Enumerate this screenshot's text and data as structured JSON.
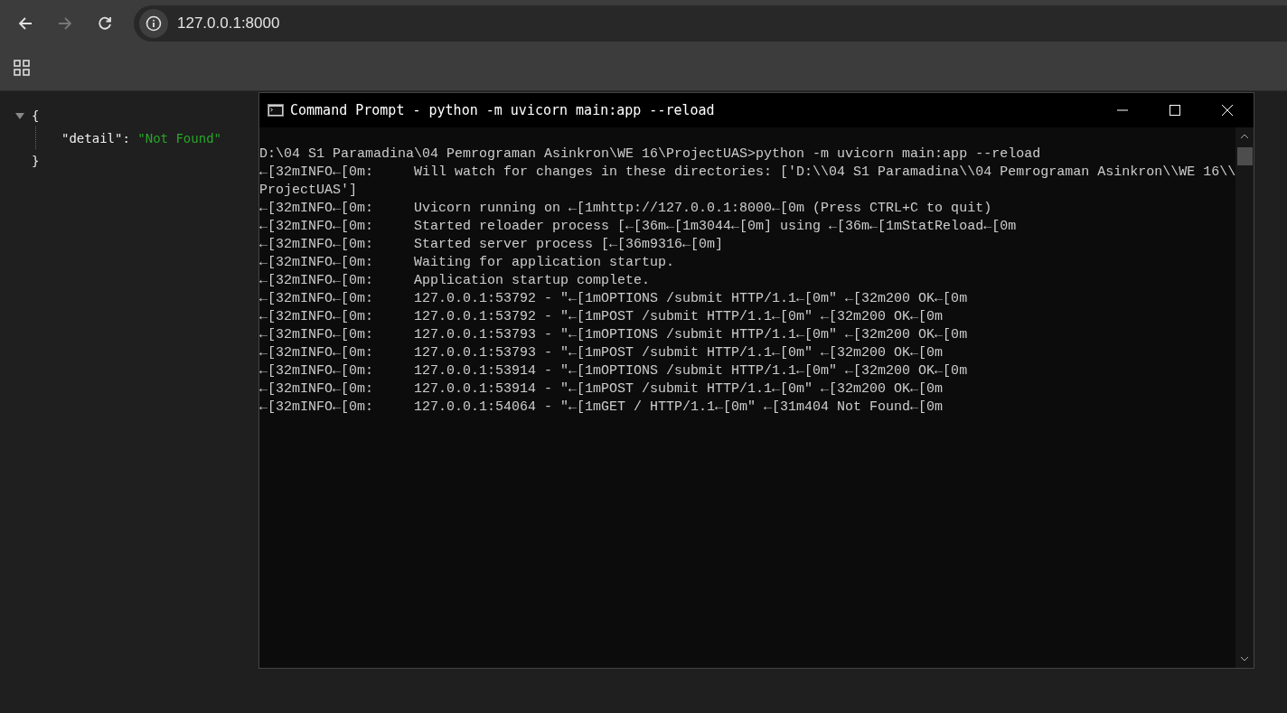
{
  "browser": {
    "address": "127.0.0.1:8000",
    "forward_disabled": true
  },
  "json_view": {
    "expanded": true,
    "open_brace": "{",
    "close_brace": "}",
    "entries": [
      {
        "key": "\"detail\"",
        "separator": ": ",
        "value": "\"Not Found\""
      }
    ]
  },
  "terminal": {
    "title": "Command Prompt - python  -m uvicorn main:app --reload",
    "lines": [
      "D:\\04 S1 Paramadina\\04 Pemrograman Asinkron\\WE 16\\ProjectUAS>python -m uvicorn main:app --reload",
      "←[32mINFO←[0m:     Will watch for changes in these directories: ['D:\\\\04 S1 Paramadina\\\\04 Pemrograman Asinkron\\\\WE 16\\\\",
      "ProjectUAS']",
      "←[32mINFO←[0m:     Uvicorn running on ←[1mhttp://127.0.0.1:8000←[0m (Press CTRL+C to quit)",
      "←[32mINFO←[0m:     Started reloader process [←[36m←[1m3044←[0m] using ←[36m←[1mStatReload←[0m",
      "←[32mINFO←[0m:     Started server process [←[36m9316←[0m]",
      "←[32mINFO←[0m:     Waiting for application startup.",
      "←[32mINFO←[0m:     Application startup complete.",
      "←[32mINFO←[0m:     127.0.0.1:53792 - \"←[1mOPTIONS /submit HTTP/1.1←[0m\" ←[32m200 OK←[0m",
      "←[32mINFO←[0m:     127.0.0.1:53792 - \"←[1mPOST /submit HTTP/1.1←[0m\" ←[32m200 OK←[0m",
      "←[32mINFO←[0m:     127.0.0.1:53793 - \"←[1mOPTIONS /submit HTTP/1.1←[0m\" ←[32m200 OK←[0m",
      "←[32mINFO←[0m:     127.0.0.1:53793 - \"←[1mPOST /submit HTTP/1.1←[0m\" ←[32m200 OK←[0m",
      "←[32mINFO←[0m:     127.0.0.1:53914 - \"←[1mOPTIONS /submit HTTP/1.1←[0m\" ←[32m200 OK←[0m",
      "←[32mINFO←[0m:     127.0.0.1:53914 - \"←[1mPOST /submit HTTP/1.1←[0m\" ←[32m200 OK←[0m",
      "←[32mINFO←[0m:     127.0.0.1:54064 - \"←[1mGET / HTTP/1.1←[0m\" ←[31m404 Not Found←[0m"
    ]
  }
}
